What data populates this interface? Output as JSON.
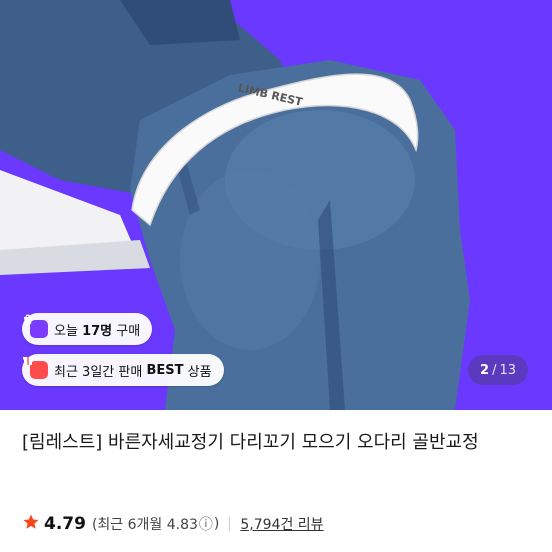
{
  "product_image": {
    "band_text": "LIMB REST",
    "background_color": "#6a38ff"
  },
  "badges": {
    "today_prefix": "오늘",
    "today_count": "17명",
    "today_suffix": "구매",
    "best_prefix": "최근 3일간 판매",
    "best_label": "BEST",
    "best_suffix": "상품"
  },
  "pager": {
    "current": "2",
    "separator": "/",
    "total": "13"
  },
  "product": {
    "title": "[림레스트] 바른자세교정기 다리꼬기 모으기 오다리 골반교정"
  },
  "rating": {
    "score": "4.79",
    "recent_label": "(최근 6개월 4.83",
    "info_icon": "ⓘ",
    "close_paren": ")",
    "review_link": "5,794건 리뷰",
    "star_color": "#f5461e"
  }
}
